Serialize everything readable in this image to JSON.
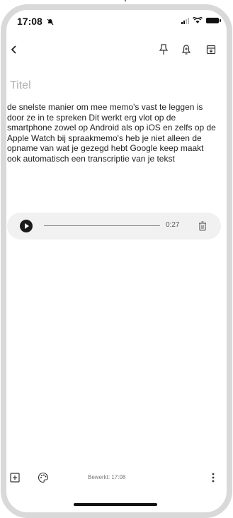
{
  "status_bar": {
    "time": "17:08",
    "dnd_icon": "bell-slash-icon",
    "signal_icon": "signal-icon",
    "wifi_icon": "wifi-icon",
    "battery_icon": "battery-icon"
  },
  "toolbar": {
    "back_icon": "back-arrow-icon",
    "pin_icon": "pin-icon",
    "reminder_icon": "bell-plus-icon",
    "archive_icon": "archive-icon"
  },
  "note": {
    "title_placeholder": "Titel",
    "body": "de snelste manier om mee memo's vast te leggen is  door ze in te spreken Dit werkt erg vlot op de smartphone zowel op Android als op iOS en zelfs op de Apple Watch bij spraakmemo's heb je niet alleen de opname van wat je gezegd hebt Google keep maakt ook automatisch een transcriptie van je tekst"
  },
  "audio": {
    "play_icon": "play-icon",
    "duration": "0:27",
    "delete_icon": "trash-icon"
  },
  "bottom_bar": {
    "add_icon": "add-box-icon",
    "palette_icon": "palette-icon",
    "edited_label": "Bewerkt: 17:08",
    "more_icon": "more-vert-icon"
  },
  "colors": {
    "frame": "#d9d9d9",
    "text": "#1f1f1f",
    "placeholder": "#b0b0b0",
    "player_bg": "#f1f1f1"
  }
}
